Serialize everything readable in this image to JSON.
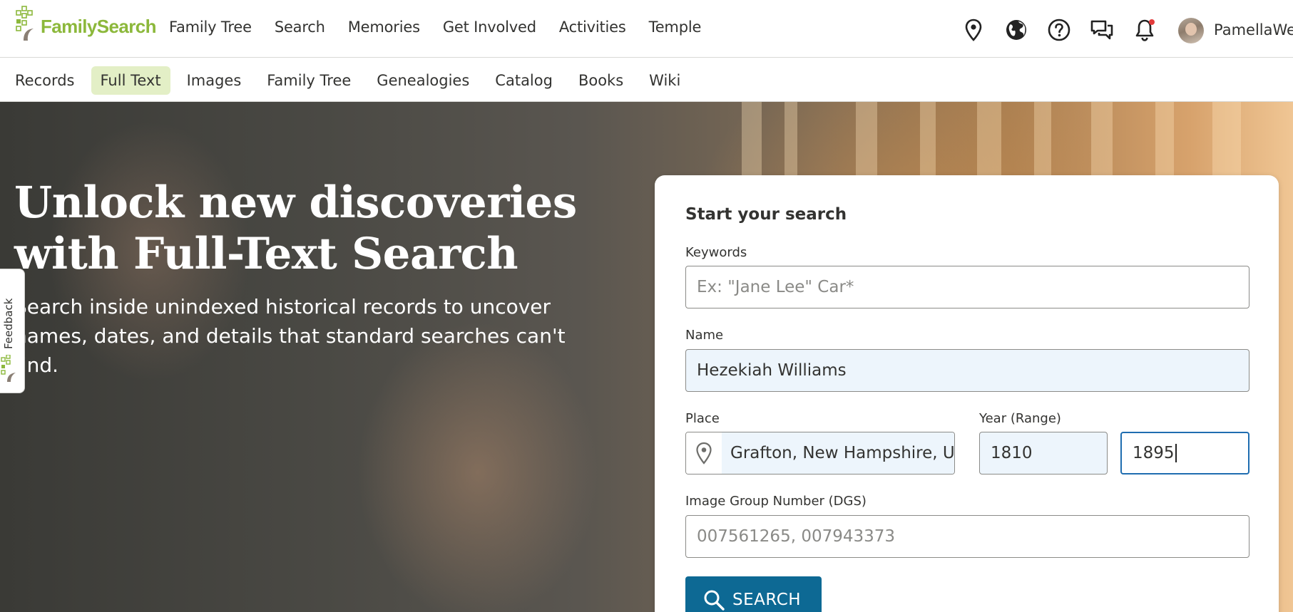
{
  "header": {
    "logo_text_1": "Family",
    "logo_text_2": "Search",
    "nav": [
      "Family Tree",
      "Search",
      "Memories",
      "Get Involved",
      "Activities",
      "Temple"
    ],
    "icons": [
      "location-pin-icon",
      "globe-icon",
      "help-icon",
      "chat-icon",
      "bell-icon"
    ],
    "username": "PamellaWe"
  },
  "subnav": {
    "items": [
      "Records",
      "Full Text",
      "Images",
      "Family Tree",
      "Genealogies",
      "Catalog",
      "Books",
      "Wiki"
    ],
    "active": "Full Text"
  },
  "hero": {
    "title": "Unlock new discoveries with Full-Text Search",
    "subtitle": "Search inside unindexed historical records to uncover names, dates, and details that standard searches can't find."
  },
  "feedback": {
    "label": "Feedback"
  },
  "search_card": {
    "title": "Start your search",
    "keywords": {
      "label": "Keywords",
      "placeholder": "Ex: \"Jane Lee\" Car*",
      "value": ""
    },
    "name": {
      "label": "Name",
      "value": "Hezekiah Williams"
    },
    "place": {
      "label": "Place",
      "value": "Grafton, New Hampshire, U"
    },
    "year": {
      "label": "Year (Range)",
      "from": "1810",
      "to": "1895"
    },
    "dgs": {
      "label": "Image Group Number (DGS)",
      "placeholder": "007561265, 007943373",
      "value": ""
    },
    "button_label": "SEARCH"
  },
  "colors": {
    "brand_green": "#8cb83b",
    "active_tab_bg": "#e3efc6",
    "button_blue": "#0d6994",
    "focus_blue": "#1f6db0",
    "filled_bg": "#edf5fc"
  }
}
